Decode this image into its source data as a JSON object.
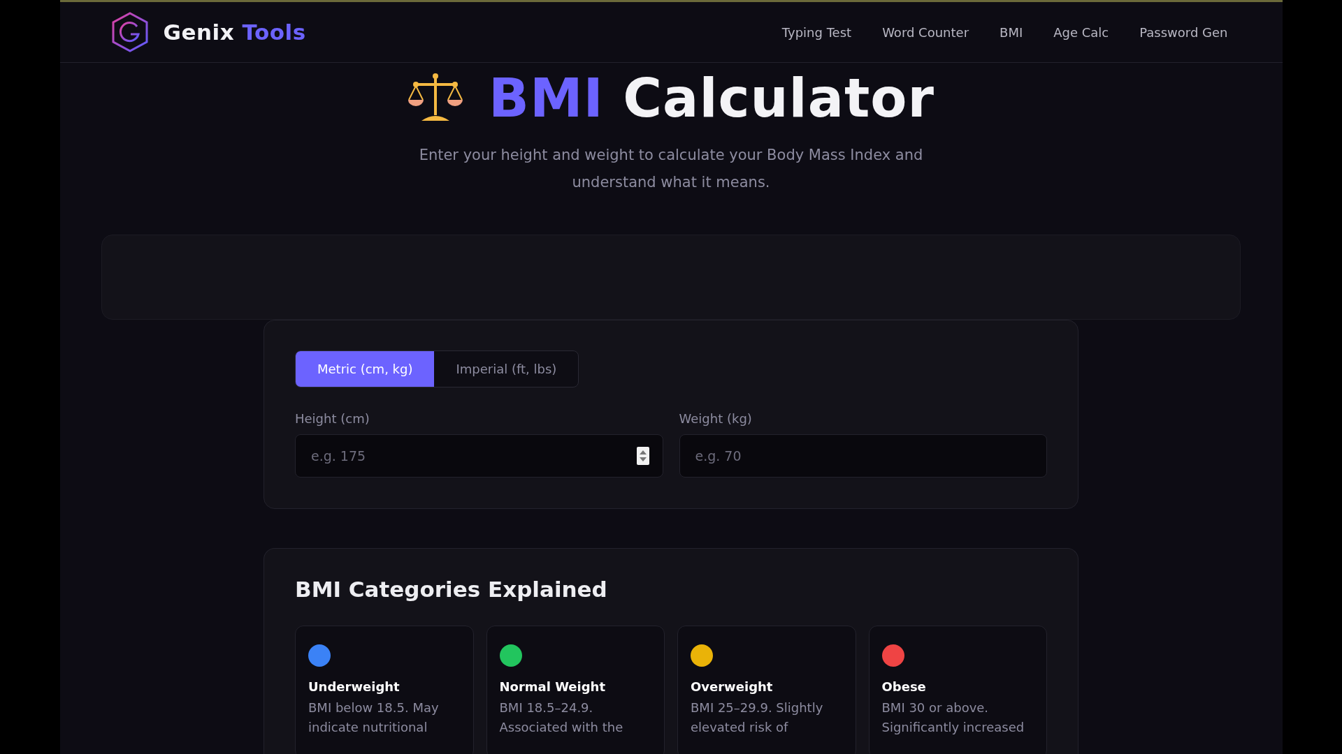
{
  "header": {
    "brand": {
      "first": "Genix",
      "second": "Tools"
    },
    "nav": [
      {
        "label": "Typing Test"
      },
      {
        "label": "Word Counter"
      },
      {
        "label": "BMI"
      },
      {
        "label": "Age Calc"
      },
      {
        "label": "Password Gen"
      }
    ]
  },
  "hero": {
    "title_highlight": "BMI",
    "title_rest": "Calculator",
    "subtitle": "Enter your height and weight to calculate your Body Mass Index and understand what it means."
  },
  "form": {
    "units": [
      {
        "label": "Metric (cm, kg)",
        "selected": true
      },
      {
        "label": "Imperial (ft, lbs)",
        "selected": false
      }
    ],
    "fields": [
      {
        "label": "Height (cm)",
        "placeholder": "e.g. 175",
        "stepper": true
      },
      {
        "label": "Weight (kg)",
        "placeholder": "e.g. 70",
        "stepper": false
      }
    ]
  },
  "categories": {
    "heading": "BMI Categories Explained",
    "items": [
      {
        "name": "Underweight",
        "description": "BMI below 18.5. May indicate nutritional",
        "color": "#3b82f6"
      },
      {
        "name": "Normal Weight",
        "description": "BMI 18.5–24.9. Associated with the",
        "color": "#22c55e"
      },
      {
        "name": "Overweight",
        "description": "BMI 25–29.9. Slightly elevated risk of",
        "color": "#eab308"
      },
      {
        "name": "Obese",
        "description": "BMI 30 or above. Significantly increased",
        "color": "#ef4444"
      }
    ]
  }
}
